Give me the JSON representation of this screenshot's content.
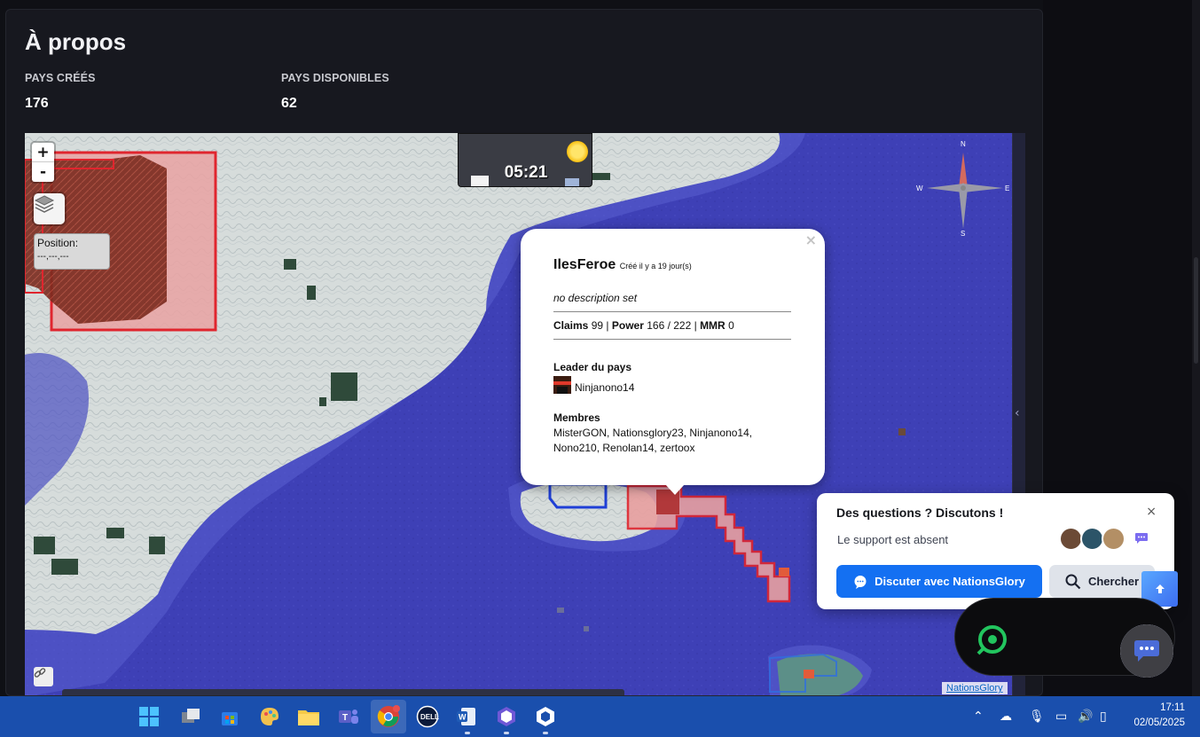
{
  "page": {
    "title": "À propos",
    "stats": [
      {
        "label": "PAYS CRÉÉS",
        "value": "176"
      },
      {
        "label": "PAYS DISPONIBLES",
        "value": "62"
      }
    ]
  },
  "map": {
    "zoom_in": "+",
    "zoom_out": "-",
    "position_label": "Position:",
    "position_value": "---,---,---",
    "clock_time": "05:21",
    "compass": {
      "n": "N",
      "s": "S",
      "e": "E",
      "w": "W"
    },
    "attribution": "NationsGlory",
    "colors": {
      "ocean": "#3d3fb3",
      "land": "#d5dcdc",
      "claim": "#e0252e"
    }
  },
  "popup": {
    "close": "×",
    "name": "IlesFeroe",
    "created": "Créé il y a 19 jour(s)",
    "description": "no description set",
    "claims_label": "Claims",
    "claims_value": "99",
    "power_label": "Power",
    "power_value": "166 / 222",
    "mmr_label": "MMR",
    "mmr_value": "0",
    "leader_heading": "Leader du pays",
    "leader_name": "Ninjanono14",
    "members_heading": "Membres",
    "members": "MisterGON, Nationsglory23, Ninjanono14, Nono210, Renolan14, zertoox"
  },
  "chat": {
    "title": "Des questions ? Discutons !",
    "close": "×",
    "status": "Le support est absent",
    "discuss_button": "Discuter avec NationsGlory",
    "search_button": "Chercher"
  },
  "taskbar": {
    "time": "17:11",
    "date": "02/05/2025",
    "accent": "#1a4fad"
  }
}
